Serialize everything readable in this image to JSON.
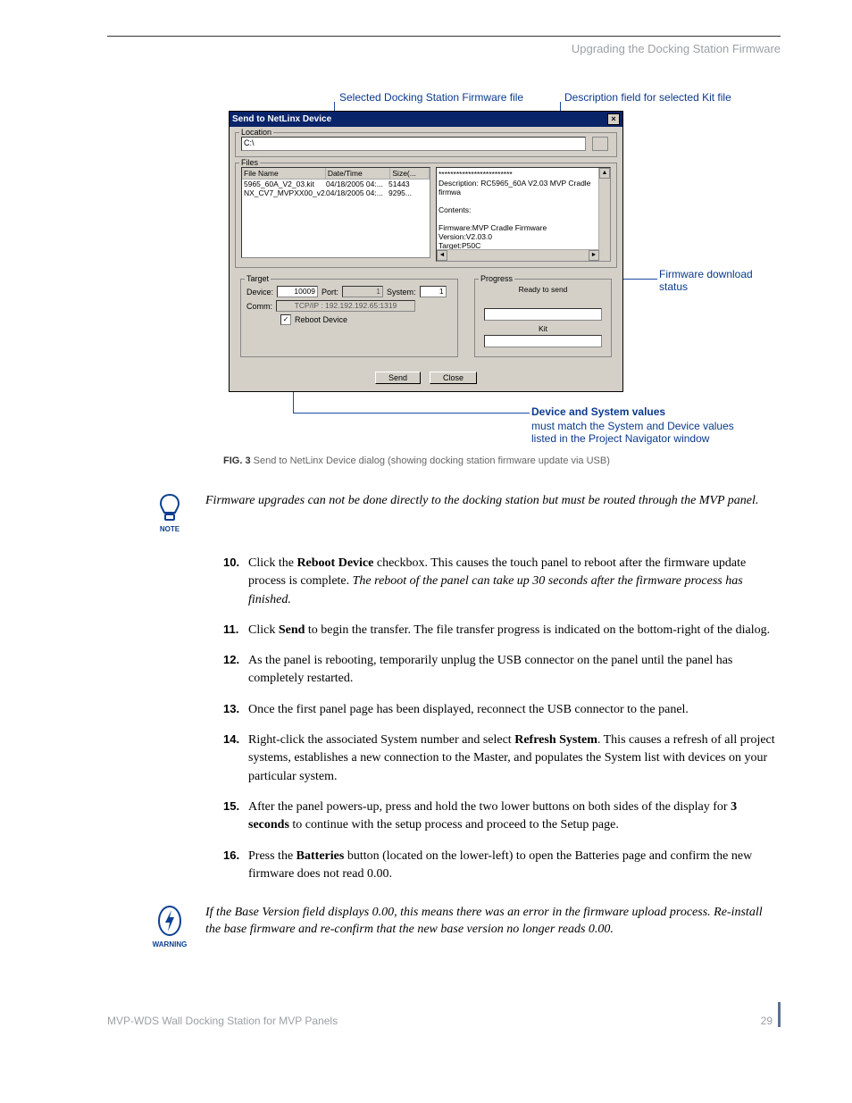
{
  "header": {
    "section_title": "Upgrading the Docking Station Firmware"
  },
  "annotations": {
    "selected_firmware": "Selected Docking Station Firmware file",
    "description_field": "Description field for selected Kit file",
    "firmware_status_1": "Firmware download",
    "firmware_status_2": "status",
    "device_values_header": "Device and System values",
    "device_values_line1": "must match the System and Device values",
    "device_values_line2": "listed in the Project Navigator window"
  },
  "dialog": {
    "title": "Send to NetLinx Device",
    "close_x": "×",
    "location": {
      "legend": "Location",
      "path": "C:\\"
    },
    "files": {
      "legend": "Files",
      "columns": {
        "name": "File Name",
        "date": "Date/Time",
        "size": "Size(..."
      },
      "rows": [
        {
          "name": "5965_60A_V2_03.kit",
          "date": "04/18/2005  04:...",
          "size": "51443"
        },
        {
          "name": "NX_CV7_MVPXX00_v2....",
          "date": "04/18/2005  04:...",
          "size": "9295..."
        }
      ],
      "description": {
        "sep": "*************************",
        "line1": "Description: RC5965_60A V2.03 MVP Cradle firmwa",
        "contents": "Contents:",
        "line2": "Firmware:MVP Cradle Firmware",
        "line3": "Version:V2.03.0",
        "line4": "Target:P50C"
      }
    },
    "target": {
      "legend": "Target",
      "device_label": "Device:",
      "device_value": "10009",
      "port_label": "Port:",
      "port_value": "1",
      "system_label": "System:",
      "system_value": "1",
      "comm_label": "Comm:",
      "comm_value": "TCP/IP : 192.192.192.65:1319",
      "reboot_label": "Reboot Device"
    },
    "progress": {
      "legend": "Progress",
      "status": "Ready to send",
      "kit": "Kit"
    },
    "buttons": {
      "send": "Send",
      "close": "Close"
    }
  },
  "figure_caption": {
    "label": "FIG. 3",
    "text": "Send to NetLinx Device dialog (showing docking station firmware update via USB)"
  },
  "note_callout": {
    "label": "NOTE",
    "text": "Firmware upgrades can not be done directly to the docking station but must be routed through the MVP panel."
  },
  "steps": [
    {
      "n": "10.",
      "html": "Click the <b>Reboot Device</b> checkbox. This causes the touch panel to reboot after the firmware update process is complete. <i>The reboot of the panel can take up 30 seconds after the firmware process has finished.</i>"
    },
    {
      "n": "11.",
      "html": "Click <b>Send</b> to begin the transfer. The file transfer progress is indicated on the bottom-right of the dialog."
    },
    {
      "n": "12.",
      "html": "As the panel is rebooting, temporarily unplug the USB connector on the panel until the panel has completely restarted."
    },
    {
      "n": "13.",
      "html": "Once the first panel page has been displayed, reconnect the USB connector to the panel."
    },
    {
      "n": "14.",
      "html": "Right-click the associated System number and select <b>Refresh System</b>. This causes a refresh of all project systems, establishes a new connection to the Master, and populates the System list with devices on your particular system."
    },
    {
      "n": "15.",
      "html": "After the panel powers-up, press and hold the two lower buttons on both sides of the display for <b>3 seconds</b> to continue with the setup process and proceed to the Setup page."
    },
    {
      "n": "16.",
      "html": "Press the <b>Batteries</b> button (located on the lower-left) to open the Batteries page and confirm the new firmware does not read 0.00."
    }
  ],
  "warning_callout": {
    "label": "WARNING",
    "text": "If the Base Version field displays 0.00, this means there was an error in the firmware upload process. Re-install the base firmware and re-confirm that the new base version no longer reads 0.00."
  },
  "footer": {
    "doc_title": "MVP-WDS Wall Docking Station for MVP Panels",
    "page_number": "29"
  }
}
